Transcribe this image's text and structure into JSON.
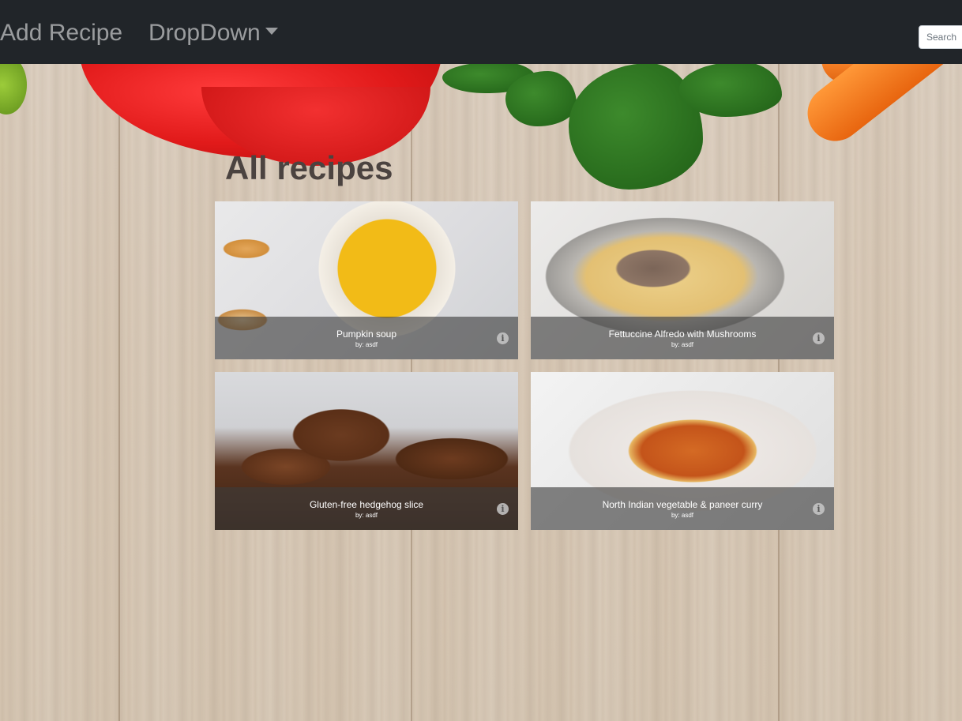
{
  "navbar": {
    "add_recipe": "Add Recipe",
    "dropdown": "DropDown",
    "search_placeholder": "Search"
  },
  "page": {
    "title": "All recipes"
  },
  "recipes": [
    {
      "title": "Pumpkin soup",
      "author": "by: asdf"
    },
    {
      "title": "Fettuccine Alfredo with Mushrooms",
      "author": "by: asdf"
    },
    {
      "title": "Gluten-free hedgehog slice",
      "author": "by: asdf"
    },
    {
      "title": "North Indian vegetable & paneer curry",
      "author": "by: asdf"
    }
  ],
  "icons": {
    "info": "info-icon",
    "caret": "chevron-down-icon"
  },
  "colors": {
    "navbar_bg": "#212529",
    "nav_text": "#8b8d8f",
    "caption_bg": "#3c3c3c"
  }
}
